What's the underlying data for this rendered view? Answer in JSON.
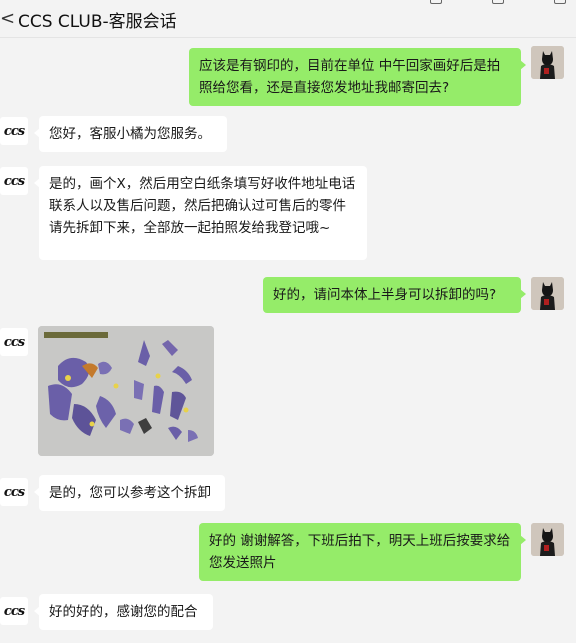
{
  "header": {
    "back_glyph": "<",
    "title": "CCS CLUB-客服会话"
  },
  "cs_avatar_text": "ccs",
  "messages": [
    {
      "side": "me",
      "text": "应该是有钢印的，目前在单位 中午回家画好后是拍照给您看，还是直接您发地址我邮寄回去?"
    },
    {
      "side": "cs",
      "text": "您好，客服小橘为您服务。"
    },
    {
      "side": "cs",
      "text": "是的，画个X，然后用空白纸条填写好收件地址电话联系人以及售后问题，然后把确认过可售后的零件请先拆卸下来，全部放一起拍照发给我登记哦~"
    },
    {
      "side": "me",
      "text": "好的，请问本体上半身可以拆卸的吗?"
    },
    {
      "side": "cs",
      "type": "image",
      "icon": "parts-breakdown-photo"
    },
    {
      "side": "cs",
      "text": "是的，您可以参考这个拆卸"
    },
    {
      "side": "me",
      "text": "好的  谢谢解答，下班后拍下，明天上班后按要求给您发送照片"
    },
    {
      "side": "cs",
      "text": "好的好的，感谢您的配合"
    }
  ],
  "colors": {
    "background": "#f3f3f3",
    "my_bubble": "#95ec69",
    "cs_bubble": "#ffffff"
  }
}
